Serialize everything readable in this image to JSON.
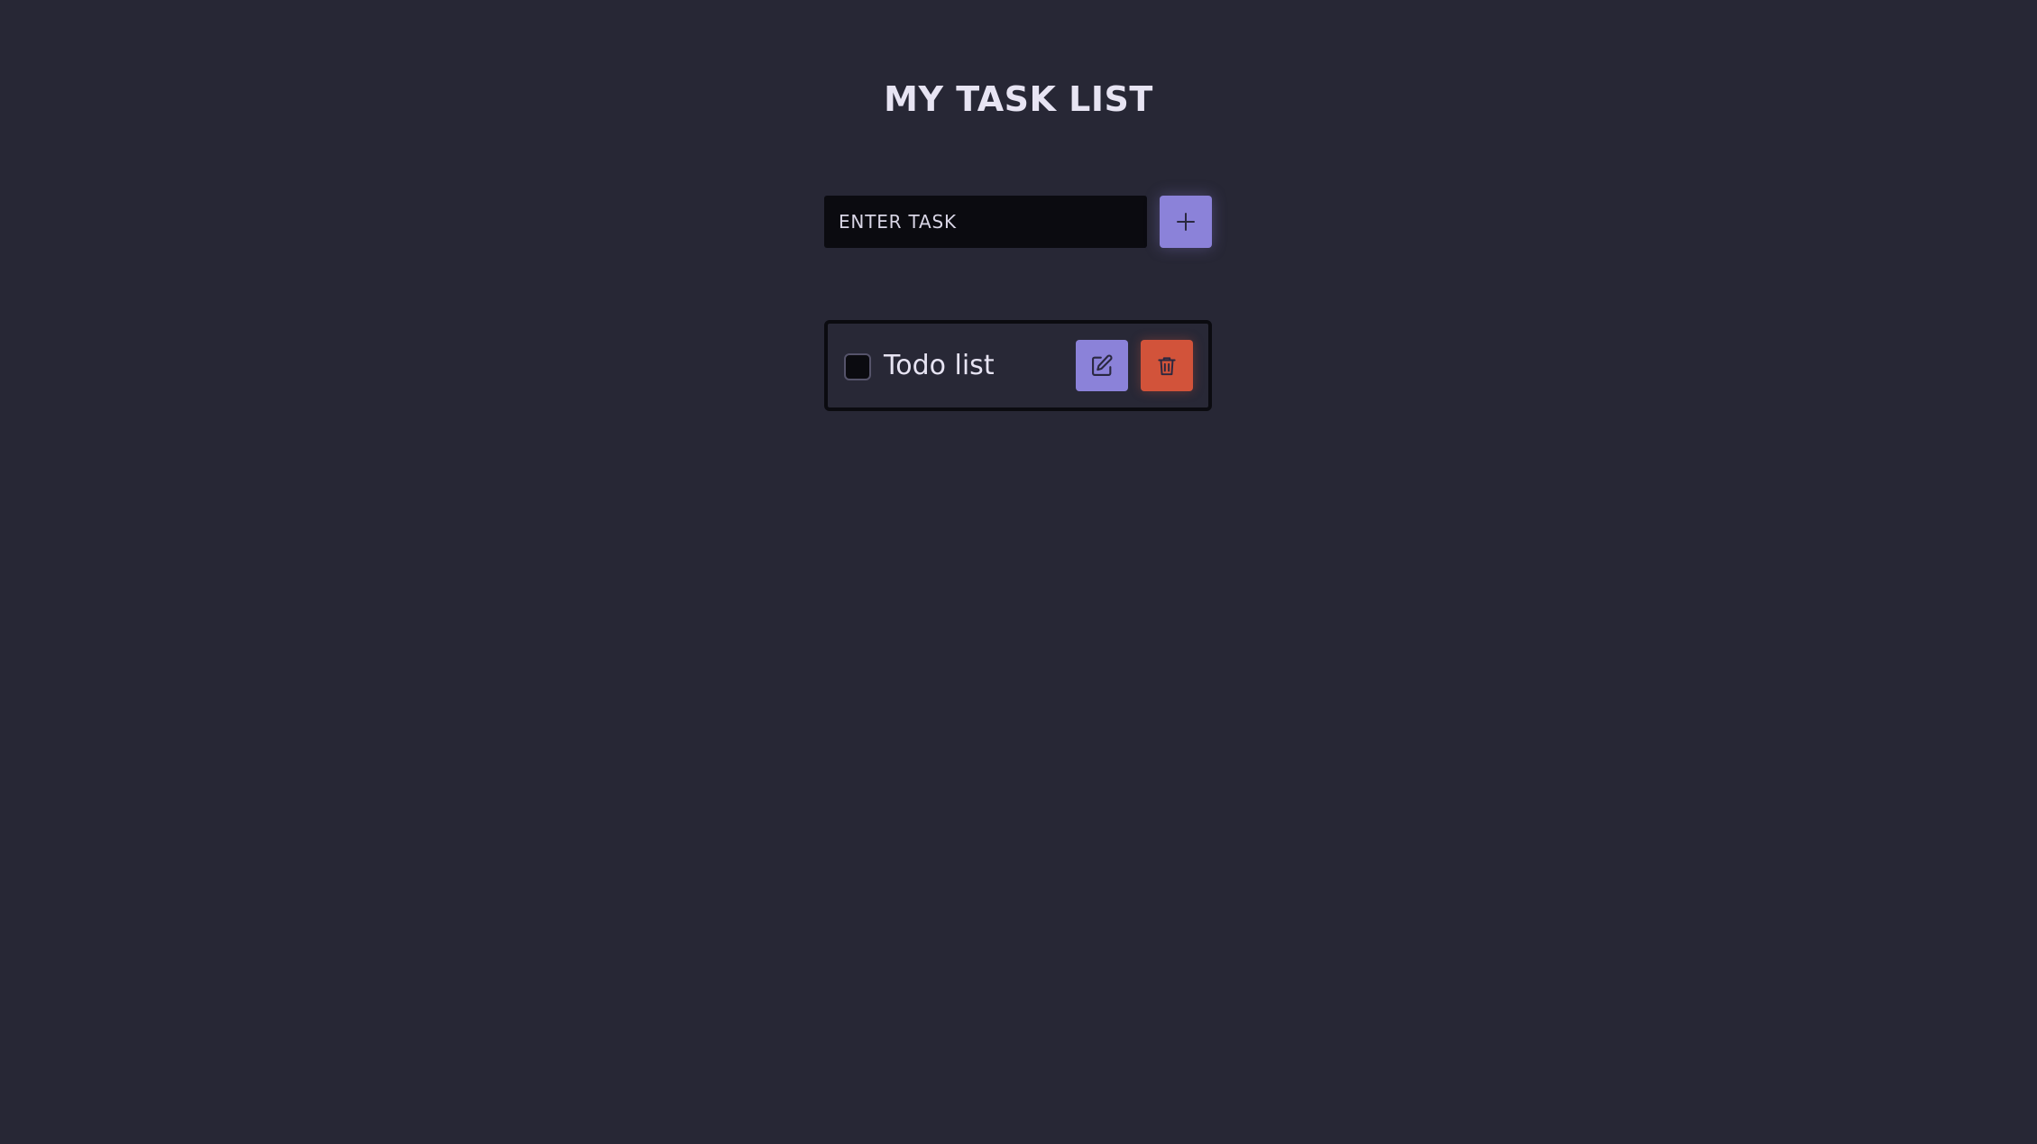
{
  "header": {
    "title": "MY TASK LIST"
  },
  "add_form": {
    "input_placeholder": "ENTER TASK",
    "input_value": "",
    "add_icon": "plus-icon"
  },
  "tasks": [
    {
      "text": "Todo list",
      "completed": false,
      "edit_icon": "edit-icon",
      "delete_icon": "trash-icon"
    }
  ],
  "colors": {
    "background": "#272735",
    "accent": "#8b82d9",
    "danger": "#d2533a",
    "input_background": "#0b0b10",
    "text": "#e7e4f3"
  }
}
